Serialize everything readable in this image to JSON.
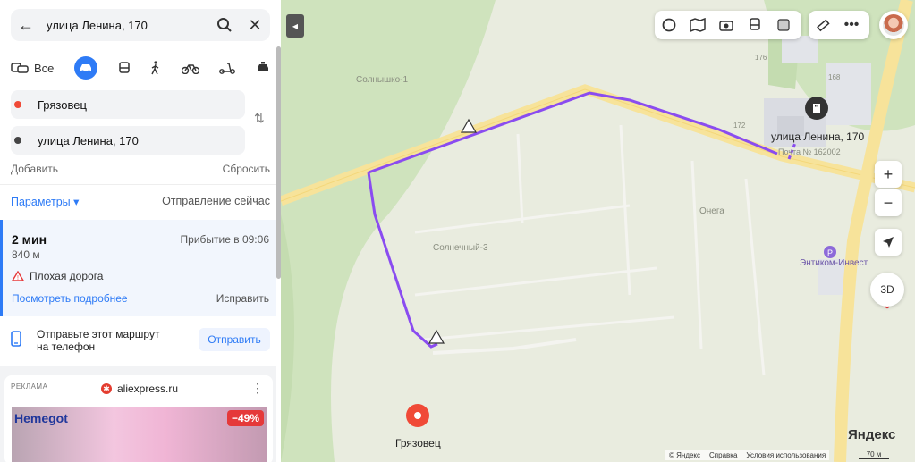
{
  "search": {
    "value": "улица Ленина, 170"
  },
  "modes": {
    "all_label": "Все"
  },
  "route_points": {
    "from": "Грязовец",
    "to": "улица Ленина, 170",
    "add": "Добавить",
    "reset": "Сбросить"
  },
  "params": {
    "label": "Параметры ▾",
    "departure": "Отправление сейчас"
  },
  "route": {
    "time": "2 мин",
    "arrival": "Прибытие в 09:06",
    "distance": "840 м",
    "warning": "Плохая дорога",
    "details": "Посмотреть подробнее",
    "fix": "Исправить"
  },
  "send": {
    "text": "Отправьте этот маршрут на телефон",
    "button": "Отправить"
  },
  "ad": {
    "tag": "РЕКЛАМА",
    "brand": "aliexpress.ru",
    "image_text": "Hemegot",
    "discount": "−49%"
  },
  "map": {
    "labels": {
      "solnyshko": "Солнышко-1",
      "solnechny": "Солнечный-3",
      "onega": "Онега",
      "entikom": "Энтиком-Инвест",
      "destination": "улица Ленина, 170",
      "post": "Почта № 162002",
      "origin": "Грязовец",
      "house_176": "176",
      "house_168": "168",
      "house_172": "172"
    },
    "zoom_in": "+",
    "zoom_out": "−",
    "mode_3d": "3D",
    "footer": {
      "copyright": "© Яндекс",
      "help": "Справка",
      "terms": "Условия использования",
      "scale": "70 м"
    },
    "brand": "Яндекс"
  },
  "colors": {
    "accent": "#2e7bf6",
    "route": "#8a4cf0",
    "origin_pin": "#f04a37",
    "road": "#f7e39a"
  }
}
